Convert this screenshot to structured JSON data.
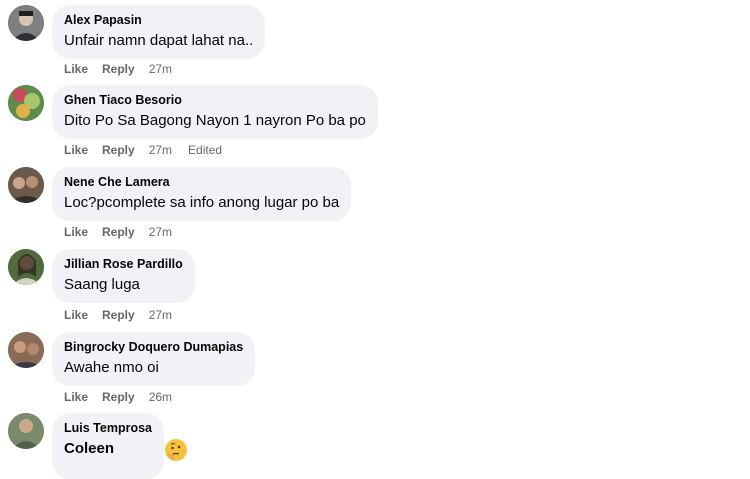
{
  "comments": [
    {
      "author": "Alex Papasin",
      "text": "Unfair namn dapat lahat na..",
      "like": "Like",
      "reply": "Reply",
      "time": "27m",
      "edited": "",
      "avatar_color": "#7d7f82"
    },
    {
      "author": "Ghen Tiaco Besorio",
      "text": "Dito Po Sa Bagong Nayon 1 nayron Po ba po",
      "like": "Like",
      "reply": "Reply",
      "time": "27m",
      "edited": "Edited",
      "avatar_color": "#5e8c4a"
    },
    {
      "author": "Nene Che Lamera",
      "text": "Loc?pcomplete sa info anong lugar po ba",
      "like": "Like",
      "reply": "Reply",
      "time": "27m",
      "edited": "",
      "avatar_color": "#6b5a4c"
    },
    {
      "author": "Jillian Rose Pardillo",
      "text": "Saang luga",
      "like": "Like",
      "reply": "Reply",
      "time": "27m",
      "edited": "",
      "avatar_color": "#4f6b3e"
    },
    {
      "author": "Bingrocky Doquero Dumapias",
      "text": "Awahe nmo oi",
      "like": "Like",
      "reply": "Reply",
      "time": "26m",
      "edited": "",
      "avatar_color": "#8a6b55"
    },
    {
      "author": "Luis Temprosa",
      "text": "Coleen",
      "like": "",
      "reply": "",
      "time": "",
      "edited": "",
      "avatar_color": "#7b8a6a"
    }
  ],
  "colors": {
    "bubble": "#f0f2f5",
    "meta": "#65676b",
    "text": "#050505"
  },
  "icons": {
    "avatar": "avatar-photo-icon",
    "emoji": "thinking-face-emoji-icon"
  }
}
